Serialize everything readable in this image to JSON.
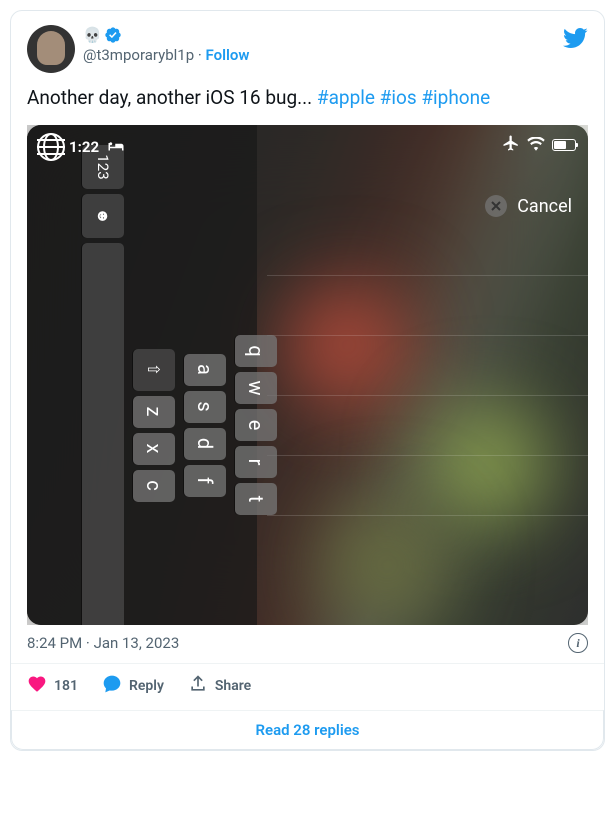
{
  "user": {
    "display_name_emoji": "💀",
    "handle": "@t3mporarybl1p",
    "follow_label": "Follow"
  },
  "tweet": {
    "text": "Another day, another iOS 16 bug... ",
    "hashtags": [
      "#apple",
      "#ios",
      "#iphone"
    ],
    "timestamp": "8:24 PM · Jan 13, 2023"
  },
  "phone": {
    "time": "1:22",
    "cancel_label": "Cancel",
    "keyboard": {
      "row1": [
        "q",
        "w",
        "e",
        "r",
        "t"
      ],
      "row2": [
        "a",
        "s",
        "d",
        "f"
      ],
      "row3_shift": "⇧",
      "row3": [
        "z",
        "x",
        "c"
      ],
      "row4_num": "123",
      "row4_emoji": "☻"
    }
  },
  "actions": {
    "likes": "181",
    "reply": "Reply",
    "share": "Share",
    "read_replies": "Read 28 replies"
  }
}
